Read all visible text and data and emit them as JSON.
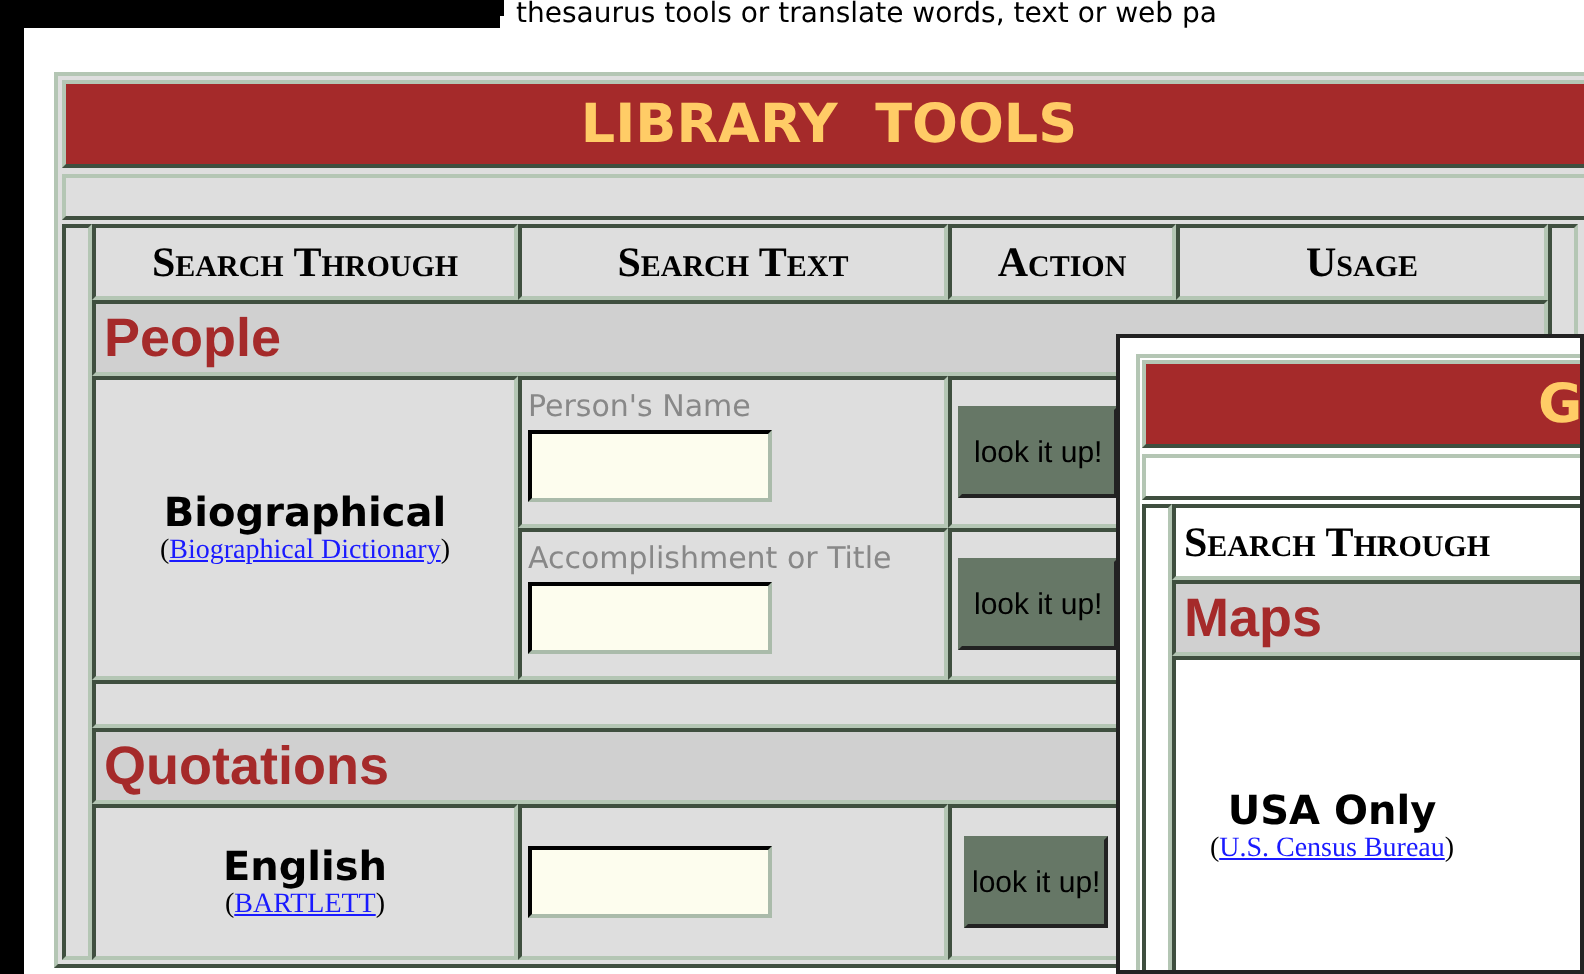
{
  "top_text": "thesaurus tools or translate words, text or web pa",
  "main": {
    "title": "LIBRARY  TOOLS",
    "columns": [
      "Search Through",
      "Search Text",
      "Action",
      "Usage"
    ],
    "sections": [
      {
        "heading": "People",
        "rows": [
          {
            "name": "Biographical",
            "source": {
              "before": "(",
              "link": "Biographical Dictionary",
              "after": ")"
            },
            "fields": [
              {
                "label": "Person's Name",
                "button": "look it up!"
              },
              {
                "label": "Accomplishment or Title",
                "button": "look it up!"
              }
            ]
          }
        ]
      },
      {
        "heading": "Quotations",
        "rows": [
          {
            "name": "English",
            "source": {
              "before": "(",
              "link": "BARTLETT",
              "after": ")"
            },
            "fields": [
              {
                "button": "look it up!"
              }
            ]
          }
        ]
      }
    ]
  },
  "overlay": {
    "title": "G",
    "columns": [
      "Search Through"
    ],
    "sections": [
      {
        "heading": "Maps",
        "rows": [
          {
            "name": "USA Only",
            "source": {
              "before": "(",
              "link": "U.S. Census Bureau",
              "after": ")"
            }
          }
        ]
      }
    ]
  }
}
